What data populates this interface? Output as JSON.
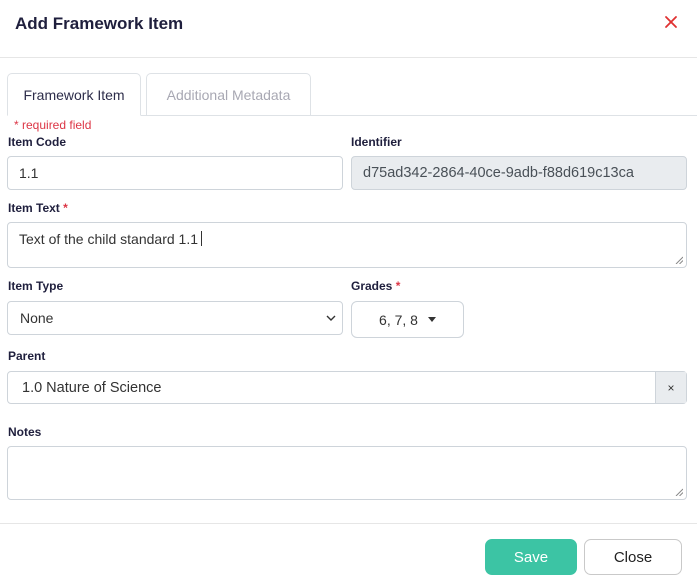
{
  "modal": {
    "title": "Add Framework Item"
  },
  "tabs": [
    {
      "label": "Framework Item",
      "active": true
    },
    {
      "label": "Additional Metadata",
      "active": false
    }
  ],
  "form": {
    "required_note": "* required field",
    "item_code": {
      "label": "Item Code",
      "value": "1.1"
    },
    "identifier": {
      "label": "Identifier",
      "value": "d75ad342-2864-40ce-9adb-f88d619c13ca"
    },
    "item_text": {
      "label": "Item Text",
      "required_mark": "*",
      "value": "Text of the child standard 1.1"
    },
    "item_type": {
      "label": "Item Type",
      "value": "None"
    },
    "grades": {
      "label": "Grades",
      "required_mark": "*",
      "value": "6, 7, 8"
    },
    "parent": {
      "label": "Parent",
      "value": "1.0 Nature of Science",
      "clear_glyph": "×"
    },
    "notes": {
      "label": "Notes",
      "value": ""
    }
  },
  "footer": {
    "save_label": "Save",
    "close_label": "Close"
  },
  "colors": {
    "accent": "#3cc4a4",
    "required": "#dc3545",
    "close_icon": "#e03131"
  },
  "icons": [
    "close-icon",
    "chevron-down-icon",
    "caret-down-icon",
    "resize-handle-icon",
    "clear-icon"
  ]
}
